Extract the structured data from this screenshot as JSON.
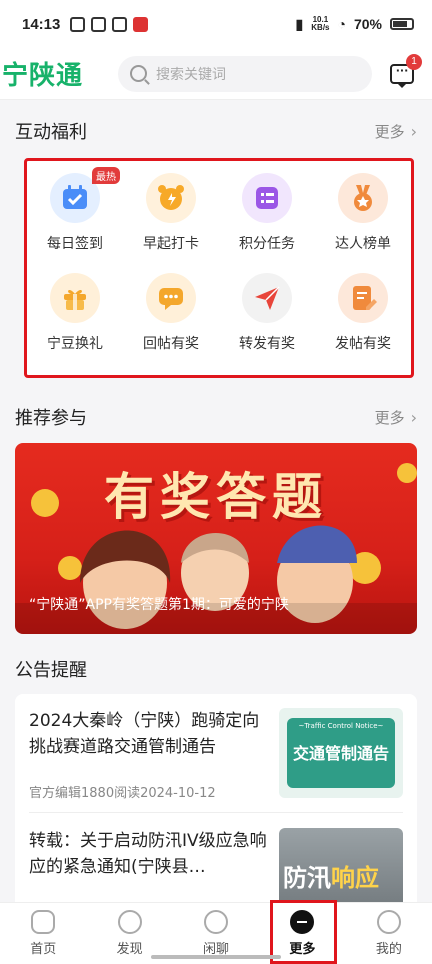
{
  "status_bar": {
    "time": "14:13",
    "net_speed": "10.1",
    "net_unit": "KB/s",
    "battery": "70%"
  },
  "header": {
    "logo": "宁陕通",
    "search_placeholder": "搜索关键词",
    "message_badge": "1"
  },
  "benefits": {
    "title": "互动福利",
    "more": "更多",
    "hot_badge": "最热",
    "items": [
      {
        "label": "每日签到",
        "icon": "calendar-check-icon",
        "color": "#4a8df8"
      },
      {
        "label": "早起打卡",
        "icon": "alarm-clock-icon",
        "color": "#f7a928"
      },
      {
        "label": "积分任务",
        "icon": "task-list-icon",
        "color": "#9b57e6"
      },
      {
        "label": "达人榜单",
        "icon": "medal-icon",
        "color": "#f08a3c"
      },
      {
        "label": "宁豆换礼",
        "icon": "gift-icon",
        "color": "#f4a72c"
      },
      {
        "label": "回帖有奖",
        "icon": "chat-bubble-icon",
        "color": "#f4a72c"
      },
      {
        "label": "转发有奖",
        "icon": "paper-plane-icon",
        "color": "#e8453a"
      },
      {
        "label": "发帖有奖",
        "icon": "edit-note-icon",
        "color": "#f08a3c"
      }
    ]
  },
  "recommend": {
    "title": "推荐参与",
    "more": "更多",
    "banner_title": "有奖答题",
    "banner_caption": "“宁陕通”APP有奖答题第1期：可爱的宁陕"
  },
  "notices": {
    "title": "公告提醒",
    "items": [
      {
        "title": "2024大秦岭（宁陕）跑骑定向挑战赛道路交通管制通告",
        "meta": "官方编辑1880阅读2024-10-12",
        "thumb_sub": "~Traffic Control Notice~",
        "thumb_text": "交通管制通告"
      },
      {
        "title": "转载：关于启动防汛IV级应急响应的紧急通知(宁陕县…",
        "thumb_text_a": "防汛",
        "thumb_text_b": "响应"
      }
    ]
  },
  "bottom_nav": [
    {
      "label": "首页",
      "icon": "home-icon"
    },
    {
      "label": "发现",
      "icon": "discover-icon"
    },
    {
      "label": "闲聊",
      "icon": "chat-icon"
    },
    {
      "label": "更多",
      "icon": "more-icon",
      "active": true
    },
    {
      "label": "我的",
      "icon": "profile-icon"
    }
  ]
}
